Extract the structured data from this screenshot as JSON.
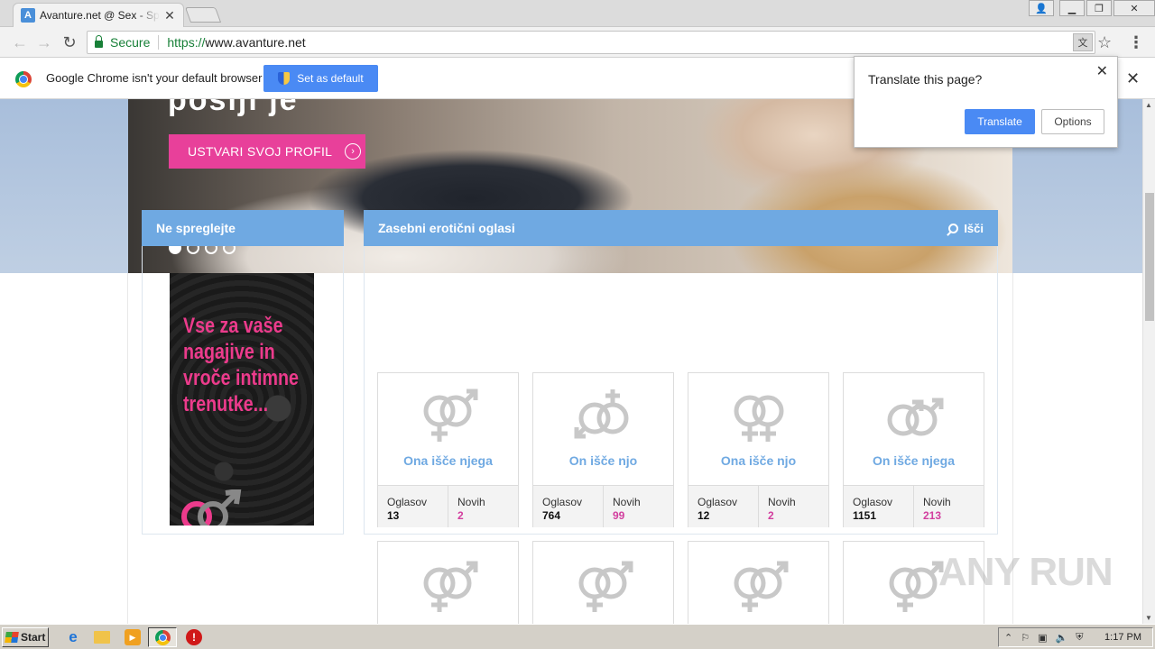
{
  "browser": {
    "tab_title": "Avanture.net @ Sex - Spletni",
    "tab_favicon": "A",
    "url_scheme": "https://",
    "url_host": "www.avanture.net",
    "secure_label": "Secure"
  },
  "infobar": {
    "message": "Google Chrome isn't your default browser",
    "button": "Set as default"
  },
  "translate_bubble": {
    "question": "Translate this page?",
    "translate_button": "Translate",
    "options_button": "Options"
  },
  "hero": {
    "title": "pošlji je",
    "cta": "USTVARI SVOJ PROFIL",
    "slides": 4,
    "active_slide": 1
  },
  "sidebar": {
    "heading": "Ne spreglejte",
    "ad_text": "Vse za vaše nagajive in vroče intimne trenutke..."
  },
  "main": {
    "heading": "Zasebni erotični oglasi",
    "search_label": "Išči",
    "stat_labels": {
      "ads": "Oglasov",
      "new": "Novih"
    },
    "cards": [
      {
        "label": "Ona išče njega",
        "ads": "13",
        "new": "2",
        "symbol": "female-male-icon"
      },
      {
        "label": "On išče njo",
        "ads": "764",
        "new": "99",
        "symbol": "male-female-icon"
      },
      {
        "label": "Ona išče njo",
        "ads": "12",
        "new": "2",
        "symbol": "female-female-icon"
      },
      {
        "label": "On išče njega",
        "ads": "1151",
        "new": "213",
        "symbol": "male-male-icon"
      }
    ]
  },
  "watermark": "ANY RUN",
  "taskbar": {
    "start": "Start",
    "clock": "1:17 PM"
  },
  "colors": {
    "accent_blue": "#6fa9e2",
    "cta_pink": "#e8409a",
    "new_count_magenta": "#d23e9e",
    "chrome_button_blue": "#4a8af4"
  }
}
